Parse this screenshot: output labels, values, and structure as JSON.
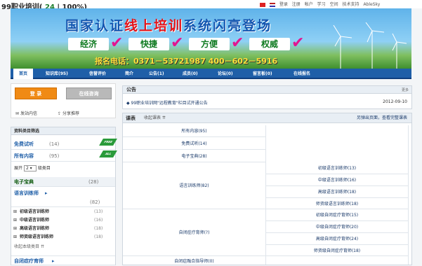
{
  "header": {
    "site_name": "99职业培训(",
    "count": "24",
    "sep": "|",
    "percent": "100%)",
    "links": [
      "登录",
      "注册",
      "帐户",
      "学习",
      "空间",
      "技术支持",
      "AbleSky"
    ]
  },
  "banner": {
    "title_a": "国家认证",
    "title_b": "线上培训",
    "title_c": "系统闪亮登场",
    "slogans": [
      "经济",
      "快捷",
      "方便",
      "权威"
    ],
    "phones": "报名电话：0371－53721987  400－602－5916"
  },
  "nav": {
    "items": [
      "首页",
      "知识库(95)",
      "信誉评价",
      "简介",
      "公告(1)",
      "成员(0)",
      "论坛(0)",
      "留言板(0)",
      "在线报名"
    ]
  },
  "login": {
    "login_label": "登 录",
    "consult_label": "在线咨询",
    "send_msg": "发站内信",
    "share": "分享推荐"
  },
  "filter": {
    "title": "资料类目筛选",
    "free": {
      "label": "免费试听",
      "count": "(14)"
    },
    "all": {
      "label": "所有内容",
      "count": "(95)"
    },
    "expand_pre": "展开",
    "expand_val": "2",
    "expand_post": "级类目",
    "ebook": {
      "label": "电子宝典",
      "count": "(28)"
    },
    "lang": {
      "label": "语言训练师",
      "count": "(82)"
    },
    "lang_subs": [
      {
        "label": "初级语言训练师",
        "count": "(13)"
      },
      {
        "label": "中级语言训练师",
        "count": "(16)"
      },
      {
        "label": "高级语言训练师",
        "count": "(18)"
      },
      {
        "label": "师资级语言训练师",
        "count": "(18)"
      }
    ],
    "collapse": "收起本级类目",
    "autism": {
      "label": "自闭症疗育师"
    }
  },
  "notice": {
    "title": "公告",
    "more": "更多",
    "item": "99职业培训网\"远程教育\"栏目试开通公告",
    "date": "2012-09-10"
  },
  "courses": {
    "tab": "课表",
    "collapse": "收起课表",
    "right_text": "另弹出页面，查看完整课表",
    "rows": [
      {
        "label": "所有内容(95)"
      },
      {
        "label": "免费试听(14)"
      },
      {
        "label": "电子宝典(28)"
      }
    ],
    "lang_group": "语言训练师(82)",
    "lang_subs": [
      "初级语言训练师(13)",
      "中级语言训练师(16)",
      "高级语言训练师(18)",
      "师资级语言训练师(18)"
    ],
    "autism_group": "自闭症疗育师(?)",
    "autism_subs": [
      "初级自闭症疗育师(15)",
      "中级自闭症疗育师(20)",
      "高级自闭症疗育师(24)",
      "师资级自闭症疗育师(18)"
    ],
    "last_row": "自闭症融合指导师(0)"
  }
}
